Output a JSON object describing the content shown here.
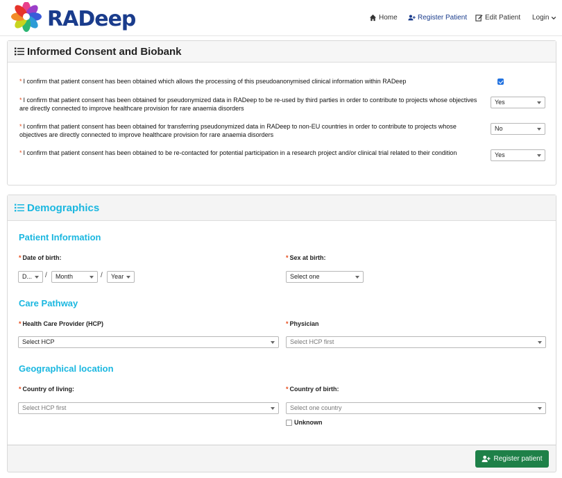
{
  "header": {
    "brand": "RADeep",
    "nav": {
      "home": "Home",
      "register": "Register Patient",
      "edit": "Edit Patient",
      "login": "Login"
    }
  },
  "consent": {
    "title": "Informed Consent and Biobank",
    "items": [
      {
        "text": "I confirm that patient consent has been obtained which allows the processing of this pseudoanonymised clinical information within RADeep"
      },
      {
        "text": "I confirm that patient consent has been obtained for pseudonymized data in RADeep to be re-used by third parties in order to contribute to projects whose objectives are directly connected to improve healthcare provision for rare anaemia disorders",
        "value": "Yes"
      },
      {
        "text": "I confirm that patient consent has been obtained for transferring pseudonymized data in RADeep to non-EU countries in order to contribute to projects whose objectives are directly connected to improve healthcare provision for rare anaemia disorders",
        "value": "No"
      },
      {
        "text": "I confirm that patient consent has been obtained to be re-contacted for potential participation in a research project and/or clinical trial related to their condition",
        "value": "Yes"
      }
    ],
    "required_marker": "*"
  },
  "demographics": {
    "title": "Demographics",
    "patient_info": {
      "title": "Patient Information",
      "dob_label": "Date of birth:",
      "dob_day": "D...",
      "dob_month": "Month",
      "dob_year": "Year",
      "dob_sep": "/",
      "sex_label": "Sex at birth:",
      "sex_value": "Select one"
    },
    "care_pathway": {
      "title": "Care Pathway",
      "hcp_label": "Health Care Provider (HCP)",
      "hcp_value": "Select HCP",
      "physician_label": "Physician",
      "physician_value": "Select HCP first"
    },
    "geo": {
      "title": "Geographical location",
      "living_label": "Country of living:",
      "living_value": "Select HCP first",
      "birth_label": "Country of birth:",
      "birth_value": "Select one country",
      "unknown_label": "Unknown"
    }
  },
  "footer": {
    "register_button": "Register patient"
  },
  "colors": {
    "brand": "#1a3c8c",
    "accent": "#1ab7e0",
    "required": "#e64a19",
    "success": "#1e8048",
    "checkbox": "#2272e0"
  }
}
